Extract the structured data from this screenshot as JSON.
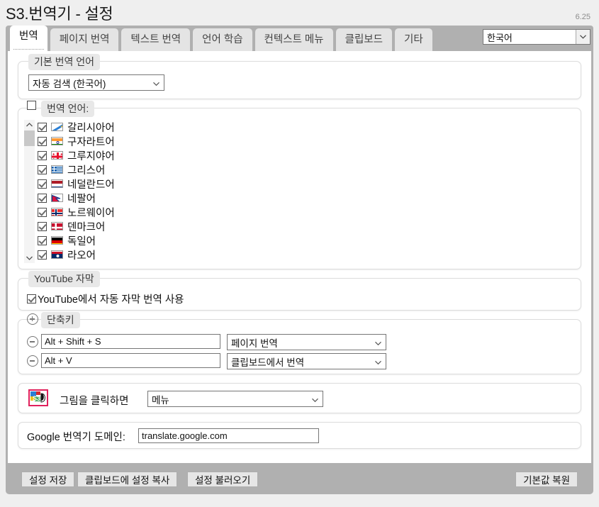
{
  "window": {
    "title": "S3.번역기 - 설정",
    "version": "6.25"
  },
  "tabs": [
    {
      "label": "번역",
      "active": true
    },
    {
      "label": "페이지 번역",
      "active": false
    },
    {
      "label": "텍스트 번역",
      "active": false
    },
    {
      "label": "언어 학습",
      "active": false
    },
    {
      "label": "컨텍스트 메뉴",
      "active": false
    },
    {
      "label": "클립보드",
      "active": false
    },
    {
      "label": "기타",
      "active": false
    }
  ],
  "ui_language": {
    "value": "한국어",
    "icon": "chevron-down-icon"
  },
  "default_language_group": {
    "title": "기본 번역 언어",
    "select_value": "자동 검색 (한국어)"
  },
  "translation_languages_group": {
    "title": "번역 언어:",
    "enabled": false,
    "scroll": {
      "up_icon": "chevron-up-icon",
      "down_icon": "chevron-down-icon"
    },
    "items": [
      {
        "label": "갈리시아어",
        "checked": true,
        "flag": "galicia"
      },
      {
        "label": "구자라트어",
        "checked": true,
        "flag": "india"
      },
      {
        "label": "그루지야어",
        "checked": true,
        "flag": "georgia"
      },
      {
        "label": "그리스어",
        "checked": true,
        "flag": "greece"
      },
      {
        "label": "네덜란드어",
        "checked": true,
        "flag": "netherlands"
      },
      {
        "label": "네팔어",
        "checked": true,
        "flag": "nepal"
      },
      {
        "label": "노르웨이어",
        "checked": true,
        "flag": "norway"
      },
      {
        "label": "덴마크어",
        "checked": true,
        "flag": "denmark"
      },
      {
        "label": "독일어",
        "checked": true,
        "flag": "germany"
      },
      {
        "label": "라오어",
        "checked": true,
        "flag": "laos"
      }
    ]
  },
  "youtube_group": {
    "title": "YouTube 자막",
    "checkbox_label": "YouTube에서 자동 자막 번역 사용",
    "checked": true
  },
  "shortcuts_group": {
    "title": "단축키",
    "add_icon": "plus-circle-icon",
    "remove_icon": "minus-circle-icon",
    "rows": [
      {
        "key": "Alt + Shift + S",
        "action": "페이지 번역"
      },
      {
        "key": "Alt + V",
        "action": "클립보드에서 번역"
      }
    ]
  },
  "image_click_group": {
    "icon": "s3-translator-icon",
    "label": "그림을 클릭하면",
    "select_value": "메뉴"
  },
  "domain_group": {
    "label": "Google 번역기 도메인:",
    "value": "translate.google.com"
  },
  "footer": {
    "save_label": "설정 저장",
    "copy_label": "클립보드에 설정 복사",
    "load_label": "설정 불러오기",
    "reset_label": "기본값 복원"
  },
  "colors": {
    "chrome": "#b0b0b0",
    "page": "#efefef",
    "accent_icon_border": "#e0215c"
  }
}
